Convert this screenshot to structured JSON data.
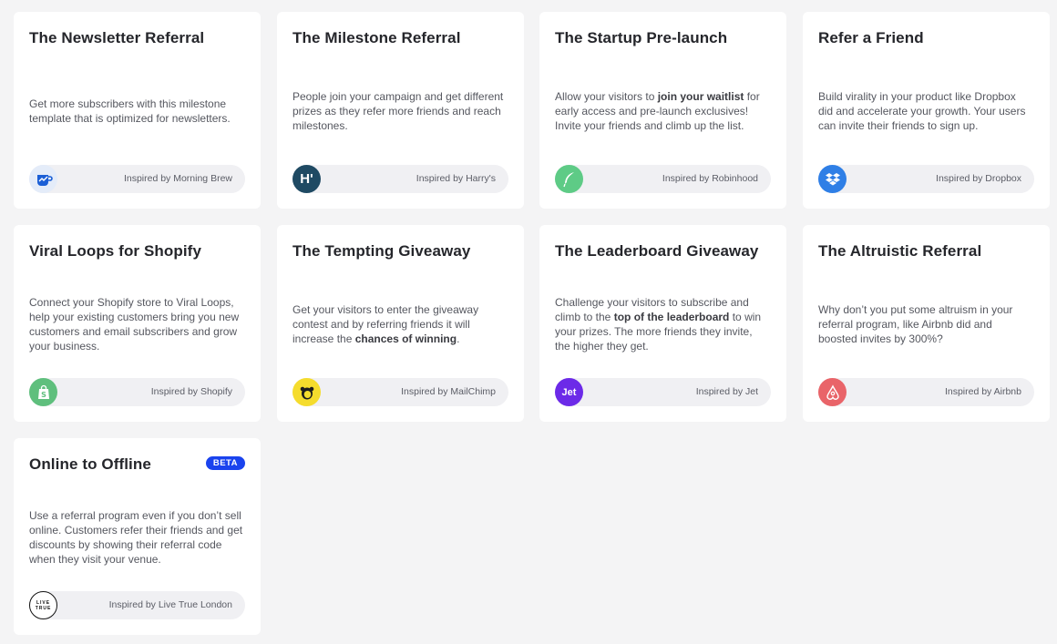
{
  "cards": [
    {
      "title": "The Newsletter Referral",
      "desc_plain": "Get more subscribers with this milestone template that is optimized for newsletters.",
      "inspired": "Inspired by Morning Brew",
      "logo_icon": "morning-brew-icon"
    },
    {
      "title": "The Milestone Referral",
      "desc_plain": "People join your campaign and get different prizes as they refer more friends and reach milestones.",
      "inspired": "Inspired by Harry's",
      "logo_text": "H'",
      "logo_icon": "harrys-icon",
      "logo_color": "#1f4a63"
    },
    {
      "title": "The Startup Pre-launch",
      "desc_pre": "Allow your visitors to ",
      "desc_bold": "join your waitlist",
      "desc_post": " for early access and pre-launch exclusives! Invite your friends and climb up the list.",
      "inspired": "Inspired by Robinhood",
      "logo_icon": "robinhood-feather-icon",
      "logo_color": "#5ecb86"
    },
    {
      "title": "Refer a Friend",
      "desc_plain": "Build virality in your product like Dropbox did and accelerate your growth. Your users can invite their friends to sign up.",
      "inspired": "Inspired by Dropbox",
      "logo_icon": "dropbox-icon",
      "logo_color": "#2f7fe6"
    },
    {
      "title": "Viral Loops for Shopify",
      "desc_plain": "Connect your Shopify store to Viral Loops, help your existing customers bring you new customers and email subscribers and grow your business.",
      "inspired": "Inspired by Shopify",
      "logo_icon": "shopify-bag-icon",
      "logo_color": "#5fbf7d"
    },
    {
      "title": "The Tempting Giveaway",
      "desc_pre": "Get your visitors to enter the giveaway contest and by referring friends it will increase the ",
      "desc_bold": "chances of winning",
      "desc_post": ".",
      "inspired": "Inspired by MailChimp",
      "logo_icon": "mailchimp-icon",
      "logo_color": "#f5dc2d"
    },
    {
      "title": "The Leaderboard Giveaway",
      "desc_pre": "Challenge your visitors to subscribe and climb to the ",
      "desc_bold": "top of the leaderboard",
      "desc_post": " to win your prizes. The more friends they invite, the higher they get.",
      "inspired": "Inspired by Jet",
      "logo_text": "Jet",
      "logo_icon": "jet-icon",
      "logo_color": "#6c2ae8"
    },
    {
      "title": "The Altruistic Referral",
      "desc_plain": "Why don’t you put some altruism in your referral program, like Airbnb did and boosted invites by 300%?",
      "inspired": "Inspired by Airbnb",
      "logo_icon": "airbnb-icon",
      "logo_color": "#e96469"
    },
    {
      "title": "Online to Offline",
      "badge": "BETA",
      "desc_plain": "Use a referral program even if you don’t sell online. Customers refer their friends and get discounts by showing their referral code when they visit your venue.",
      "inspired": "Inspired by Live True London",
      "logo_text": "LIVE TRUE",
      "logo_icon": "live-true-london-icon"
    }
  ],
  "colors": {
    "background": "#f4f4f5",
    "card": "#ffffff",
    "pill": "#f0f0f3",
    "beta": "#1a43ee"
  }
}
